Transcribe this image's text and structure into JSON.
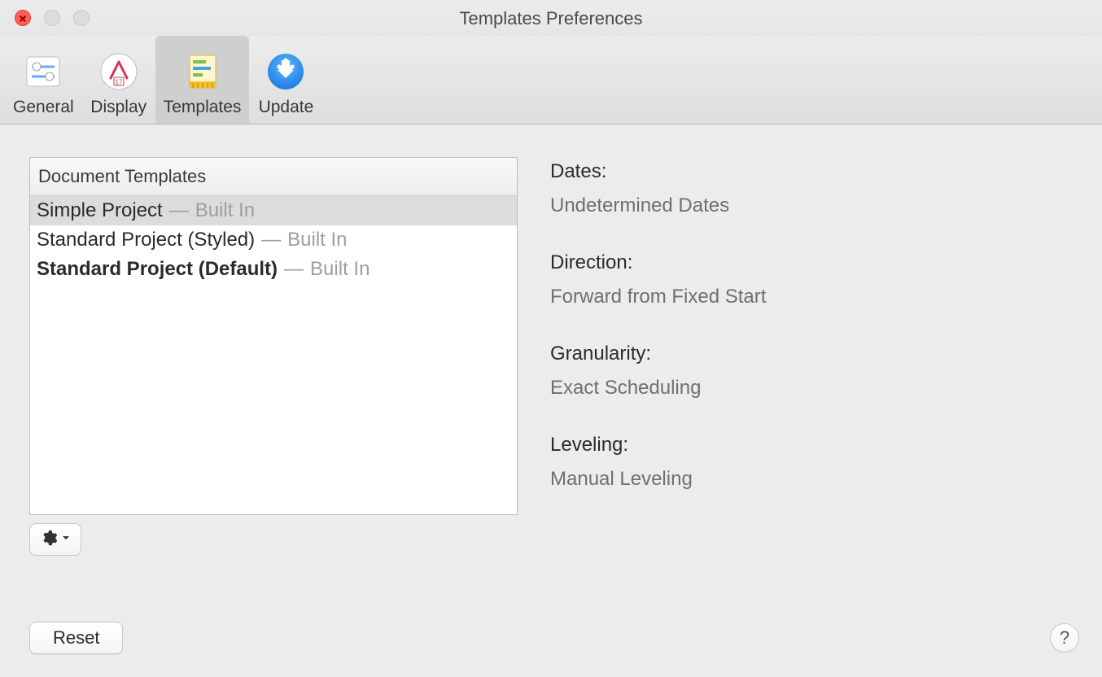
{
  "window": {
    "title": "Templates Preferences"
  },
  "toolbar": {
    "items": [
      {
        "label": "General",
        "selected": false
      },
      {
        "label": "Display",
        "selected": false
      },
      {
        "label": "Templates",
        "selected": true
      },
      {
        "label": "Update",
        "selected": false
      }
    ]
  },
  "templates": {
    "list_header": "Document Templates",
    "dash": "—",
    "items": [
      {
        "name": "Simple Project",
        "tag": "Built In",
        "selected": true,
        "bold": false
      },
      {
        "name": "Standard Project (Styled)",
        "tag": "Built In",
        "selected": false,
        "bold": false
      },
      {
        "name": "Standard Project (Default)",
        "tag": "Built In",
        "selected": false,
        "bold": true
      }
    ]
  },
  "details": {
    "fields": [
      {
        "label": "Dates:",
        "value": "Undetermined Dates"
      },
      {
        "label": "Direction:",
        "value": "Forward from Fixed Start"
      },
      {
        "label": "Granularity:",
        "value": "Exact Scheduling"
      },
      {
        "label": "Leveling:",
        "value": "Manual Leveling"
      }
    ]
  },
  "buttons": {
    "reset": "Reset",
    "help": "?"
  }
}
